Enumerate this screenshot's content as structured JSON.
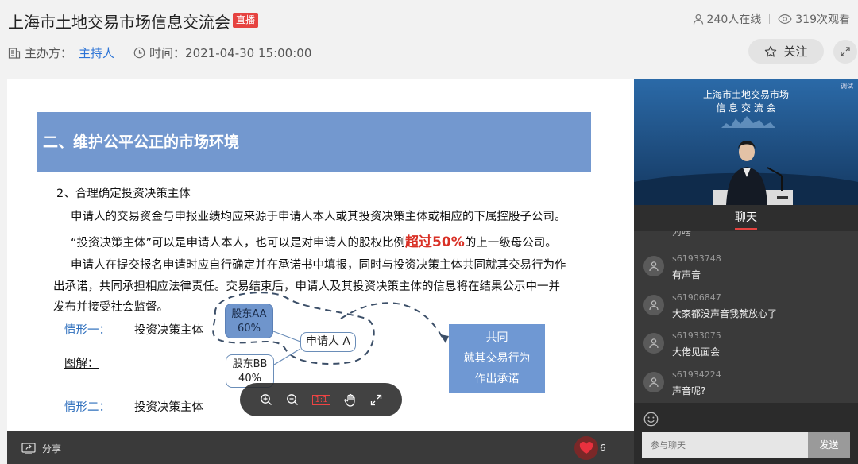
{
  "header": {
    "title": "上海市土地交易市场信息交流会",
    "live_badge": "直播",
    "online": "240人在线",
    "views": "319次观看",
    "organizer_label": "主办方：",
    "organizer": "主持人",
    "time_label": "时间：",
    "time": "2021-04-30 15:00:00",
    "follow": "关注"
  },
  "slide": {
    "banner": "二、维护公平公正的市场环境",
    "subheading": "2、合理确定投资决策主体",
    "para1": "申请人的交易资金与申报业绩均应来源于申请人本人或其投资决策主体或相应的下属控股子公司。",
    "para2_a": "“投资决策主体”可以是申请人本人，也可以是对申请人的股权比例",
    "para2_highlight": "超过50%",
    "para2_b": "的上一级母公司。",
    "para3_l1": "申请人在提交报名申请时应自行确定并在承诺书中填报，同时与投资决策主体共同就其交易行为作",
    "para3_l2": "出承诺，共同承担相应法律责任。交易结束后，申请人及其投资决策主体的信息将在结果公示中一并",
    "para3_l3": "发布并接受社会监督。",
    "case1": "情形一：",
    "case1_text": "投资决策主体",
    "diagram_label": "图解：",
    "case2": "情形二：",
    "case2_text": "投资决策主体",
    "shareholder_a": "股东AA",
    "shareholder_a_pct": "60%",
    "shareholder_b": "股东BB",
    "shareholder_b_pct": "40%",
    "applicant": "申请人 A",
    "joint_l1": "共同",
    "joint_l2": "就其交易行为",
    "joint_l3": "作出承诺",
    "viewer_ratio": "1:1"
  },
  "bottom": {
    "share": "分享",
    "likes": "6"
  },
  "video": {
    "title_l1": "上海市土地交易市场",
    "title_l2": "信 息 交 流 会",
    "mark": "调试"
  },
  "chat": {
    "tab": "聊天",
    "partial_top": "为啥",
    "messages": [
      {
        "user": "s61933748",
        "text": "有声音"
      },
      {
        "user": "s61906847",
        "text": "大家都没声音我就放心了"
      },
      {
        "user": "s61933075",
        "text": "大佬见面会"
      },
      {
        "user": "s61934224",
        "text": "声音呢?"
      }
    ],
    "input_placeholder": "参与聊天",
    "send": "发送"
  },
  "colors": {
    "live_red": "#e64340",
    "link_blue": "#2b73d6",
    "slide_blue": "#7398cf",
    "highlight_red": "#d93025"
  }
}
